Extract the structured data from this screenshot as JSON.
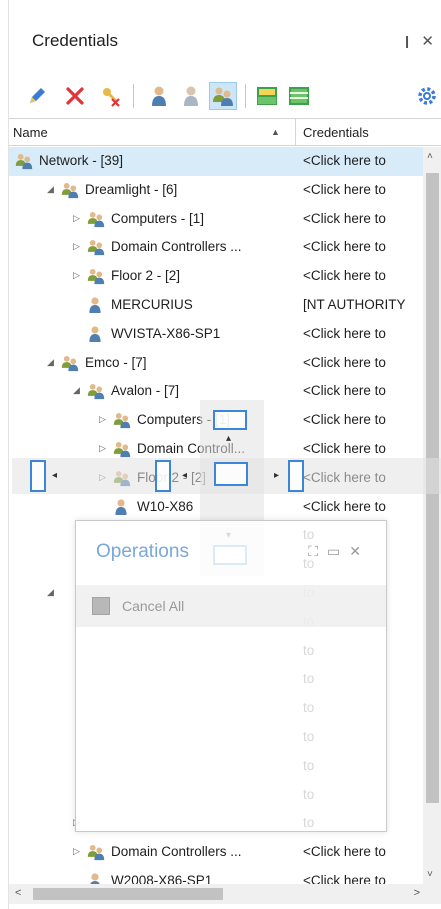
{
  "panel": {
    "title": "Credentials",
    "pin_glyph": "❙",
    "close_glyph": "✕"
  },
  "toolbar": {
    "buttons": [
      {
        "name": "edit-pencil-icon"
      },
      {
        "name": "delete-x-icon"
      },
      {
        "name": "clear-credentials-icon"
      },
      {
        "name": "user-icon"
      },
      {
        "name": "user-gray-icon"
      },
      {
        "name": "group-icon",
        "active": true
      },
      {
        "name": "split-horizontal-icon"
      },
      {
        "name": "split-grid-icon"
      },
      {
        "name": "settings-gear-icon"
      }
    ]
  },
  "grid": {
    "col_name": "Name",
    "col_credentials": "Credentials",
    "sort_glyph": "▲"
  },
  "rows": [
    {
      "label": "Network - [39]",
      "cred": "<Click here to",
      "level": 0,
      "exp": "",
      "icon": "group",
      "selected": true
    },
    {
      "label": "Dreamlight - [6]",
      "cred": "<Click here to",
      "level": 1,
      "exp": "◢",
      "icon": "group"
    },
    {
      "label": "Computers - [1]",
      "cred": "<Click here to",
      "level": 2,
      "exp": "▷",
      "icon": "group"
    },
    {
      "label": "Domain Controllers ...",
      "cred": "<Click here to",
      "level": 2,
      "exp": "▷",
      "icon": "group"
    },
    {
      "label": "Floor 2 - [2]",
      "cred": "<Click here to",
      "level": 2,
      "exp": "▷",
      "icon": "group"
    },
    {
      "label": "MERCURIUS",
      "cred": "[NT AUTHORITY",
      "level": 2,
      "exp": "",
      "icon": "user"
    },
    {
      "label": "WVISTA-X86-SP1",
      "cred": "<Click here to",
      "level": 2,
      "exp": "",
      "icon": "user"
    },
    {
      "label": "Emco - [7]",
      "cred": "<Click here to",
      "level": 1,
      "exp": "◢",
      "icon": "group"
    },
    {
      "label": "Avalon - [7]",
      "cred": "<Click here to",
      "level": 2,
      "exp": "◢",
      "icon": "group"
    },
    {
      "label": "Computers - [1]",
      "cred": "<Click here to",
      "level": 3,
      "exp": "▷",
      "icon": "group"
    },
    {
      "label": "Domain Controll...",
      "cred": "<Click here to",
      "level": 3,
      "exp": "▷",
      "icon": "group"
    },
    {
      "label": "Floor 2 - [2]",
      "cred": "<Click here to",
      "level": 3,
      "exp": "▷",
      "icon": "group"
    },
    {
      "label": "W10-X86",
      "cred": "<Click here to",
      "level": 3,
      "exp": "",
      "icon": "user"
    },
    {
      "label": "",
      "cred": "to",
      "level": 3,
      "exp": "",
      "icon": ""
    },
    {
      "label": "",
      "cred": "to",
      "level": 3,
      "exp": "",
      "icon": ""
    },
    {
      "label": "",
      "cred": "to",
      "level": 1,
      "exp": "◢",
      "icon": ""
    },
    {
      "label": "",
      "cred": "to",
      "level": 2,
      "exp": "",
      "icon": ""
    },
    {
      "label": "",
      "cred": "to",
      "level": 2,
      "exp": "",
      "icon": ""
    },
    {
      "label": "",
      "cred": "to",
      "level": 2,
      "exp": "",
      "icon": ""
    },
    {
      "label": "",
      "cred": "to",
      "level": 2,
      "exp": "",
      "icon": ""
    },
    {
      "label": "",
      "cred": "to",
      "level": 2,
      "exp": "",
      "icon": ""
    },
    {
      "label": "",
      "cred": "to",
      "level": 2,
      "exp": "",
      "icon": ""
    },
    {
      "label": "",
      "cred": "to",
      "level": 2,
      "exp": "",
      "icon": ""
    },
    {
      "label": "",
      "cred": "to",
      "level": 2,
      "exp": "▷",
      "icon": ""
    },
    {
      "label": "Domain Controllers ...",
      "cred": "<Click here to",
      "level": 2,
      "exp": "▷",
      "icon": "group"
    },
    {
      "label": "W2008-X86-SP1",
      "cred": "<Click here to",
      "level": 2,
      "exp": "",
      "icon": "user"
    }
  ],
  "operations": {
    "title": "Operations",
    "buttons_glyphs": "⛶▭✕",
    "cancel_all": "Cancel All"
  },
  "colors": {
    "selected": "#d7ebf9",
    "accent": "#3b86d8",
    "group_icon": "#8aa83a",
    "user_icon": "#5b7fa6"
  }
}
